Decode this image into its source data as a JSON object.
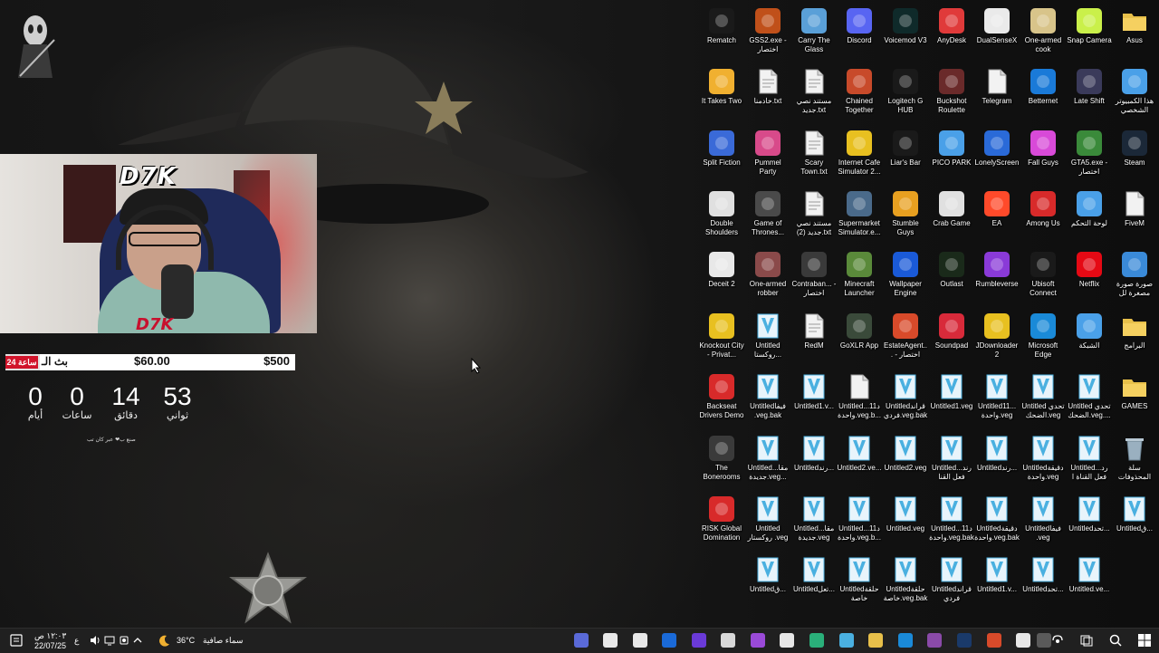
{
  "overlay": {
    "goal_tag": "24 ساعة",
    "goal_label": "بث الـ",
    "goal_current": "$60.00",
    "goal_target": "$500",
    "goal_progress": 0.12,
    "timer": [
      {
        "value": "0",
        "label": "أيام"
      },
      {
        "value": "0",
        "label": "ساعات"
      },
      {
        "value": "14",
        "label": "دقائق"
      },
      {
        "value": "53",
        "label": "ثواني"
      }
    ],
    "timer_credit": "صنع ب❤ عبر كان تب",
    "streamer_logo": "D7K"
  },
  "desktop_icons": [
    [
      {
        "label": "Rematch",
        "icon": "unreal-icon",
        "color": "#1a1a1a"
      },
      {
        "label": "GSS2.exe - اختصار",
        "icon": "gss2-icon",
        "color": "#c0501a"
      },
      {
        "label": "Carry The Glass",
        "icon": "carry-glass-icon",
        "color": "#5aa0d8"
      },
      {
        "label": "Discord",
        "icon": "discord-icon",
        "color": "#5865f2"
      },
      {
        "label": "Voicemod V3",
        "icon": "voicemod-icon",
        "color": "#0f2a2a"
      },
      {
        "label": "AnyDesk",
        "icon": "anydesk-icon",
        "color": "#e03a3a"
      },
      {
        "label": "DualSenseX",
        "icon": "dualsense-icon",
        "color": "#eaeaea"
      },
      {
        "label": "One-armed cook",
        "icon": "one-armed-cook-icon",
        "color": "#d8c48a"
      },
      {
        "label": "Snap Camera",
        "icon": "snap-camera-icon",
        "color": "#caf04a"
      },
      {
        "label": "Asus",
        "icon": "folder-icon",
        "color": "#e8c04a"
      }
    ],
    [
      {
        "label": "It Takes Two",
        "icon": "it-takes-two-icon",
        "color": "#f0b030"
      },
      {
        "label": "خادمنا.txt",
        "icon": "text-file-icon",
        "color": "#f2f2f2"
      },
      {
        "label": "مستند نصي جديد.txt",
        "icon": "text-file-icon",
        "color": "#f2f2f2"
      },
      {
        "label": "Chained Together",
        "icon": "chained-together-icon",
        "color": "#c84a2a"
      },
      {
        "label": "Logitech G HUB",
        "icon": "logitech-icon",
        "color": "#1a1a1a"
      },
      {
        "label": "Buckshot Roulette",
        "icon": "buckshot-icon",
        "color": "#6a2a2a"
      },
      {
        "label": "Telegram",
        "icon": "file-icon",
        "color": "#f2f2f2"
      },
      {
        "label": "Betternet",
        "icon": "betternet-icon",
        "color": "#1a7ad8"
      },
      {
        "label": "Late Shift",
        "icon": "late-shift-icon",
        "color": "#3a3a5a"
      },
      {
        "label": "هذا الكمبيوتر الشخصي",
        "icon": "this-pc-icon",
        "color": "#4aa0e8"
      }
    ],
    [
      {
        "label": "Split Fiction",
        "icon": "split-fiction-icon",
        "color": "#3a6ad8"
      },
      {
        "label": "Pummel Party",
        "icon": "pummel-party-icon",
        "color": "#d84a8a"
      },
      {
        "label": "Scary Town.txt",
        "icon": "text-file-icon",
        "color": "#f2f2f2"
      },
      {
        "label": "Internet Cafe Simulator 2...",
        "icon": "ics2-icon",
        "color": "#e8c020"
      },
      {
        "label": "Liar's Bar",
        "icon": "liars-bar-icon",
        "color": "#1a1a1a"
      },
      {
        "label": "PICO PARK",
        "icon": "pico-park-icon",
        "color": "#4aa0e8"
      },
      {
        "label": "LonelyScreen",
        "icon": "lonelyscreen-icon",
        "color": "#2a6ad8"
      },
      {
        "label": "Fall Guys",
        "icon": "fall-guys-icon",
        "color": "#d84ad8"
      },
      {
        "label": "GTA5.exe - اختصار",
        "icon": "gta5-icon",
        "color": "#3a8a3a"
      },
      {
        "label": "Steam",
        "icon": "steam-icon",
        "color": "#1b2838"
      }
    ],
    [
      {
        "label": "Double Shoulders",
        "icon": "double-shoulders-icon",
        "color": "#e0e0e0"
      },
      {
        "label": "Game of Thrones...",
        "icon": "got-icon",
        "color": "#4a4a4a"
      },
      {
        "label": "مستند نصي جديد (2).txt",
        "icon": "text-file-icon",
        "color": "#f2f2f2"
      },
      {
        "label": "Supermarket Simulator.e...",
        "icon": "supermarket-icon",
        "color": "#4a6a8a"
      },
      {
        "label": "Stumble Guys",
        "icon": "stumble-guys-icon",
        "color": "#e8a020"
      },
      {
        "label": "Crab Game",
        "icon": "crab-game-icon",
        "color": "#e0e0e0"
      },
      {
        "label": "EA",
        "icon": "ea-icon",
        "color": "#ff4a2a"
      },
      {
        "label": "Among Us",
        "icon": "among-us-icon",
        "color": "#d82a2a"
      },
      {
        "label": "لوحة التحكم",
        "icon": "control-panel-icon",
        "color": "#4aa0e8"
      },
      {
        "label": "FiveM",
        "icon": "file-icon",
        "color": "#f2f2f2"
      }
    ],
    [
      {
        "label": "Deceit 2",
        "icon": "deceit-icon",
        "color": "#e8e8e8"
      },
      {
        "label": "One-armed robber",
        "icon": "one-armed-robber-icon",
        "color": "#8a4a4a"
      },
      {
        "label": "Contraban... - اختصار",
        "icon": "contraband-icon",
        "color": "#3a3a3a"
      },
      {
        "label": "Minecraft Launcher",
        "icon": "minecraft-icon",
        "color": "#5a8a3a"
      },
      {
        "label": "Wallpaper Engine",
        "icon": "wallpaper-engine-icon",
        "color": "#1a5ad8"
      },
      {
        "label": "Outlast",
        "icon": "outlast-icon",
        "color": "#1a2a1a"
      },
      {
        "label": "Rumbleverse",
        "icon": "rumbleverse-icon",
        "color": "#8a3ad8"
      },
      {
        "label": "Ubisoft Connect",
        "icon": "ubisoft-icon",
        "color": "#1a1a1a"
      },
      {
        "label": "Netflix",
        "icon": "netflix-icon",
        "color": "#e50914"
      },
      {
        "label": "صورة صورة مصغرة لل",
        "icon": "image-icon",
        "color": "#3a8ad8"
      }
    ],
    [
      {
        "label": "Knockout City - Privat...",
        "icon": "knockout-city-icon",
        "color": "#e8c020"
      },
      {
        "label": "Untitled روكستا...",
        "icon": "vegas-project-icon",
        "color": "#4ab0e0"
      },
      {
        "label": "RedM",
        "icon": "text-file-icon",
        "color": "#f2f2f2"
      },
      {
        "label": "GoXLR App",
        "icon": "goxlr-icon",
        "color": "#3a4a3a"
      },
      {
        "label": "EstateAgent... - اختصار",
        "icon": "estate-agent-icon",
        "color": "#d84a2a"
      },
      {
        "label": "Soundpad",
        "icon": "soundpad-icon",
        "color": "#d82a3a"
      },
      {
        "label": "JDownloader 2",
        "icon": "jdownloader-icon",
        "color": "#e8c020"
      },
      {
        "label": "Microsoft Edge",
        "icon": "edge-icon",
        "color": "#1a8ad8"
      },
      {
        "label": "الشبكة",
        "icon": "network-icon",
        "color": "#4aa0e8"
      },
      {
        "label": "البرامج",
        "icon": "folder-icon",
        "color": "#e8c04a"
      }
    ],
    [
      {
        "label": "Backseat Drivers Demo",
        "icon": "backseat-drivers-icon",
        "color": "#d82a2a"
      },
      {
        "label": "Untitledفيفا .veg.bak",
        "icon": "vegas-project-icon",
        "color": "#4ab0e0"
      },
      {
        "label": "Untitled1.v...",
        "icon": "vegas-project-icon",
        "color": "#4ab0e0"
      },
      {
        "label": "Untitledد11... واحدة.veg.b...",
        "icon": "file-icon",
        "color": "#f2f2f2"
      },
      {
        "label": "Untitledقراند فردي.veg.bak",
        "icon": "vegas-project-icon",
        "color": "#4ab0e0"
      },
      {
        "label": "Untitled1.veg",
        "icon": "vegas-project-icon",
        "color": "#4ab0e0"
      },
      {
        "label": "Untitled11... واحدة.veg",
        "icon": "vegas-project-icon",
        "color": "#4ab0e0"
      },
      {
        "label": "Untitled تحدي الضحك.veg",
        "icon": "vegas-project-icon",
        "color": "#4ab0e0"
      },
      {
        "label": "Untitled تحدي الضحك.veg....",
        "icon": "vegas-project-icon",
        "color": "#4ab0e0"
      },
      {
        "label": "GAMES",
        "icon": "folder-icon",
        "color": "#e8c04a"
      }
    ],
    [
      {
        "label": "The Bonerooms",
        "icon": "bonerooms-icon",
        "color": "#3a3a3a"
      },
      {
        "label": "Untitledمقا... جديدة.veg...",
        "icon": "vegas-project-icon",
        "color": "#4ab0e0"
      },
      {
        "label": "Untitledرند...",
        "icon": "vegas-project-icon",
        "color": "#4ab0e0"
      },
      {
        "label": "Untitled2.ve...",
        "icon": "vegas-project-icon",
        "color": "#4ab0e0"
      },
      {
        "label": "Untitled2.veg",
        "icon": "vegas-project-icon",
        "color": "#4ab0e0"
      },
      {
        "label": "Untitledرند... فعل القنا",
        "icon": "vegas-project-icon",
        "color": "#4ab0e0"
      },
      {
        "label": "Untitledرند...",
        "icon": "vegas-project-icon",
        "color": "#4ab0e0"
      },
      {
        "label": "Untitledدقيقة واحدة.veg",
        "icon": "vegas-project-icon",
        "color": "#4ab0e0"
      },
      {
        "label": "Untitledرد... فعل القناة ا",
        "icon": "vegas-project-icon",
        "color": "#4ab0e0"
      },
      {
        "label": "سلة المحذوفات",
        "icon": "recycle-bin-icon",
        "color": "#9ab0c0"
      }
    ],
    [
      {
        "label": "RISK Global Domination",
        "icon": "risk-icon",
        "color": "#d82a2a"
      },
      {
        "label": "Untitled روكستار .veg",
        "icon": "vegas-project-icon",
        "color": "#4ab0e0"
      },
      {
        "label": "Untitledمقا... جديدة.veg",
        "icon": "vegas-project-icon",
        "color": "#4ab0e0"
      },
      {
        "label": "Untitledد11... واحدة.veg.b...",
        "icon": "vegas-project-icon",
        "color": "#4ab0e0"
      },
      {
        "label": "Untitled.veg",
        "icon": "vegas-project-icon",
        "color": "#4ab0e0"
      },
      {
        "label": "Untitledد11... واحدة.veg.bak",
        "icon": "vegas-project-icon",
        "color": "#4ab0e0"
      },
      {
        "label": "Untitledدقيقة واحدة.veg.bak",
        "icon": "vegas-project-icon",
        "color": "#4ab0e0"
      },
      {
        "label": "Untitledفيفا .veg",
        "icon": "vegas-project-icon",
        "color": "#4ab0e0"
      },
      {
        "label": "Untitledتحد...",
        "icon": "vegas-project-icon",
        "color": "#4ab0e0"
      },
      {
        "label": "Untitledق...",
        "icon": "vegas-project-icon",
        "color": "#4ab0e0"
      }
    ],
    [
      null,
      {
        "label": "Untitledق...",
        "icon": "vegas-project-icon",
        "color": "#4ab0e0"
      },
      {
        "label": "Untitledتعل...",
        "icon": "vegas-project-icon",
        "color": "#4ab0e0"
      },
      {
        "label": "Untitledحلقة خاصة",
        "icon": "vegas-project-icon",
        "color": "#4ab0e0"
      },
      {
        "label": "Untitledحلقة خاصة.veg.bak",
        "icon": "vegas-project-icon",
        "color": "#4ab0e0"
      },
      {
        "label": "Untitledقراند فردي",
        "icon": "vegas-project-icon",
        "color": "#4ab0e0"
      },
      {
        "label": "Untitled1.v...",
        "icon": "vegas-project-icon",
        "color": "#4ab0e0"
      },
      {
        "label": "Untitledتحد...",
        "icon": "vegas-project-icon",
        "color": "#4ab0e0"
      },
      {
        "label": "Untitled.ve...",
        "icon": "vegas-project-icon",
        "color": "#4ab0e0"
      },
      null
    ]
  ],
  "taskbar": {
    "time": "١٢:٠٣ ص",
    "date": "22/07/25",
    "lang": "ع",
    "weather_temp": "36°C",
    "weather_text": "سماء صافية",
    "apps": [
      {
        "name": "taskbar-app-video-icon",
        "color": "#5a6ad8"
      },
      {
        "name": "taskbar-app-file1-icon",
        "color": "#e8e8e8"
      },
      {
        "name": "taskbar-app-file2-icon",
        "color": "#e8e8e8"
      },
      {
        "name": "taskbar-app-outlook-icon",
        "color": "#1a6ad8"
      },
      {
        "name": "taskbar-app-obs-icon",
        "color": "#6a3ad8"
      },
      {
        "name": "taskbar-app-pen-icon",
        "color": "#d8d8d8"
      },
      {
        "name": "taskbar-app-circle-icon",
        "color": "#9a4ad8"
      },
      {
        "name": "taskbar-app-file3-icon",
        "color": "#e8e8e8"
      },
      {
        "name": "taskbar-app-chat-icon",
        "color": "#2ab07a"
      },
      {
        "name": "taskbar-app-vegas-icon",
        "color": "#4ab0e0"
      },
      {
        "name": "taskbar-app-explorer-icon",
        "color": "#e8c04a"
      },
      {
        "name": "taskbar-app-edge-icon",
        "color": "#1a8ad8"
      },
      {
        "name": "taskbar-app-winrar-icon",
        "color": "#8a4aa8"
      },
      {
        "name": "taskbar-app-photoshop-icon",
        "color": "#1a3a6a"
      },
      {
        "name": "taskbar-app-chrome-icon",
        "color": "#d84a2a"
      },
      {
        "name": "taskbar-app-capcut-icon",
        "color": "#e8e8e8"
      },
      {
        "name": "taskbar-app-unknown-icon",
        "color": "#5a5a5a"
      }
    ]
  }
}
